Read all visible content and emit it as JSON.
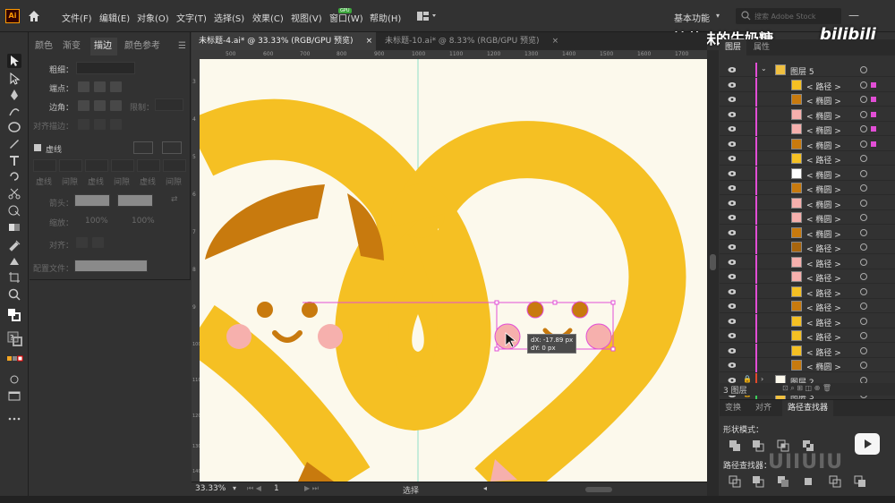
{
  "app": {
    "logo": "Ai",
    "menu": [
      "文件(F)",
      "编辑(E)",
      "对象(O)",
      "文字(T)",
      "选择(S)",
      "效果(C)",
      "视图(V)",
      "窗口(W)",
      "帮助(H)"
    ],
    "mem_badge": "GPU",
    "workspace": "基本功能",
    "search_placeholder": "搜索 Adobe Stock",
    "watermark_title": "抹茶味的牛奶糖_",
    "watermark_logo": "bilibili"
  },
  "left_panel": {
    "tabs": [
      "颜色",
      "渐变",
      "描边",
      "颜色参考"
    ],
    "active_tab": "描边",
    "weight_label": "粗细：",
    "cap_label": "端点：",
    "corner_label": "边角：",
    "limit_label": "限制：",
    "align_label": "对齐描边：",
    "dashed_label": "虚线",
    "dash_labels": [
      "虚线",
      "间隙",
      "虚线",
      "间隙",
      "虚线",
      "间隙"
    ],
    "arrow_label": "箭头：",
    "scale_label": "缩放：",
    "scale_value_1": "100%",
    "scale_value_2": "100%",
    "arrow_align_label": "对齐：",
    "profile_label": "配置文件："
  },
  "doc_tabs": [
    {
      "label": "未标题-4.ai* @ 33.33% (RGB/GPU 预览)",
      "close": "×"
    },
    {
      "label": "未标题-10.ai* @ 8.33% (RGB/GPU 预览)",
      "close": "×"
    }
  ],
  "rulers": {
    "top": [
      "500",
      "600",
      "700",
      "800",
      "900",
      "1000",
      "1100",
      "1200",
      "1300",
      "1400",
      "1500",
      "1600",
      "1700"
    ],
    "left": [
      "3",
      "4",
      "5",
      "6",
      "7",
      "8",
      "9",
      "1000",
      "1100",
      "1200",
      "1300",
      "1400"
    ]
  },
  "tooltip": {
    "dx": "dX: -17.89 px",
    "dy": "dY: 0 px"
  },
  "status": {
    "zoom": "33.33%",
    "page": "1",
    "mode": "选择"
  },
  "layers_panel": {
    "tabs": [
      "图层",
      "属性"
    ],
    "active_tab": "图层",
    "rows": [
      {
        "label": "图层 5",
        "type": "layer",
        "thumb": "#f0c040"
      },
      {
        "label": "< 路径 >",
        "type": "item",
        "thumb": "#f5c023"
      },
      {
        "label": "< 椭圆 >",
        "type": "item",
        "thumb": "#c87a0e"
      },
      {
        "label": "< 椭圆 >",
        "type": "item",
        "thumb": "#f6b0ad"
      },
      {
        "label": "< 椭圆 >",
        "type": "item",
        "thumb": "#f6b0ad"
      },
      {
        "label": "< 椭圆 >",
        "type": "item",
        "thumb": "#c87a0e"
      },
      {
        "label": "< 路径 >",
        "type": "item",
        "thumb": "#f5c023"
      },
      {
        "label": "< 椭圆 >",
        "type": "item",
        "thumb": "#ffffff"
      },
      {
        "label": "< 椭圆 >",
        "type": "item",
        "thumb": "#c87a0e"
      },
      {
        "label": "< 椭圆 >",
        "type": "item",
        "thumb": "#f6b0ad"
      },
      {
        "label": "< 椭圆 >",
        "type": "item",
        "thumb": "#f6b0ad"
      },
      {
        "label": "< 椭圆 >",
        "type": "item",
        "thumb": "#c87a0e"
      },
      {
        "label": "< 路径 >",
        "type": "item",
        "thumb": "#a8650d"
      },
      {
        "label": "< 路径 >",
        "type": "item",
        "thumb": "#f6b0ad"
      },
      {
        "label": "< 路径 >",
        "type": "item",
        "thumb": "#f6b0ad"
      },
      {
        "label": "< 路径 >",
        "type": "item",
        "thumb": "#f5c023"
      },
      {
        "label": "< 路径 >",
        "type": "item",
        "thumb": "#c87a0e"
      },
      {
        "label": "< 路径 >",
        "type": "item",
        "thumb": "#f5c023"
      },
      {
        "label": "< 路径 >",
        "type": "item",
        "thumb": "#f5c023"
      },
      {
        "label": "< 路径 >",
        "type": "item",
        "thumb": "#f5c023"
      },
      {
        "label": "< 椭圆 >",
        "type": "item",
        "thumb": "#c87a0e"
      },
      {
        "label": "图层 2",
        "type": "layer",
        "thumb": "#fcf9ec"
      },
      {
        "label": "图层 3",
        "type": "layer",
        "thumb": "#f0c040"
      }
    ],
    "footer_count": "3 图层"
  },
  "pathfinder": {
    "tabs": [
      "变换",
      "对齐",
      "路径查找器"
    ],
    "active_tab": "路径查找器",
    "shape_modes_label": "形状模式：",
    "pathfinders_label": "路径查找器："
  },
  "colors": {
    "canvas": "#fcf9ec",
    "noodle": "#f5c023",
    "hair": "#c87a0e",
    "cheek": "#f6b0ad",
    "selection": "#e24ed6"
  },
  "watermark_bottom": "UIIUIU"
}
